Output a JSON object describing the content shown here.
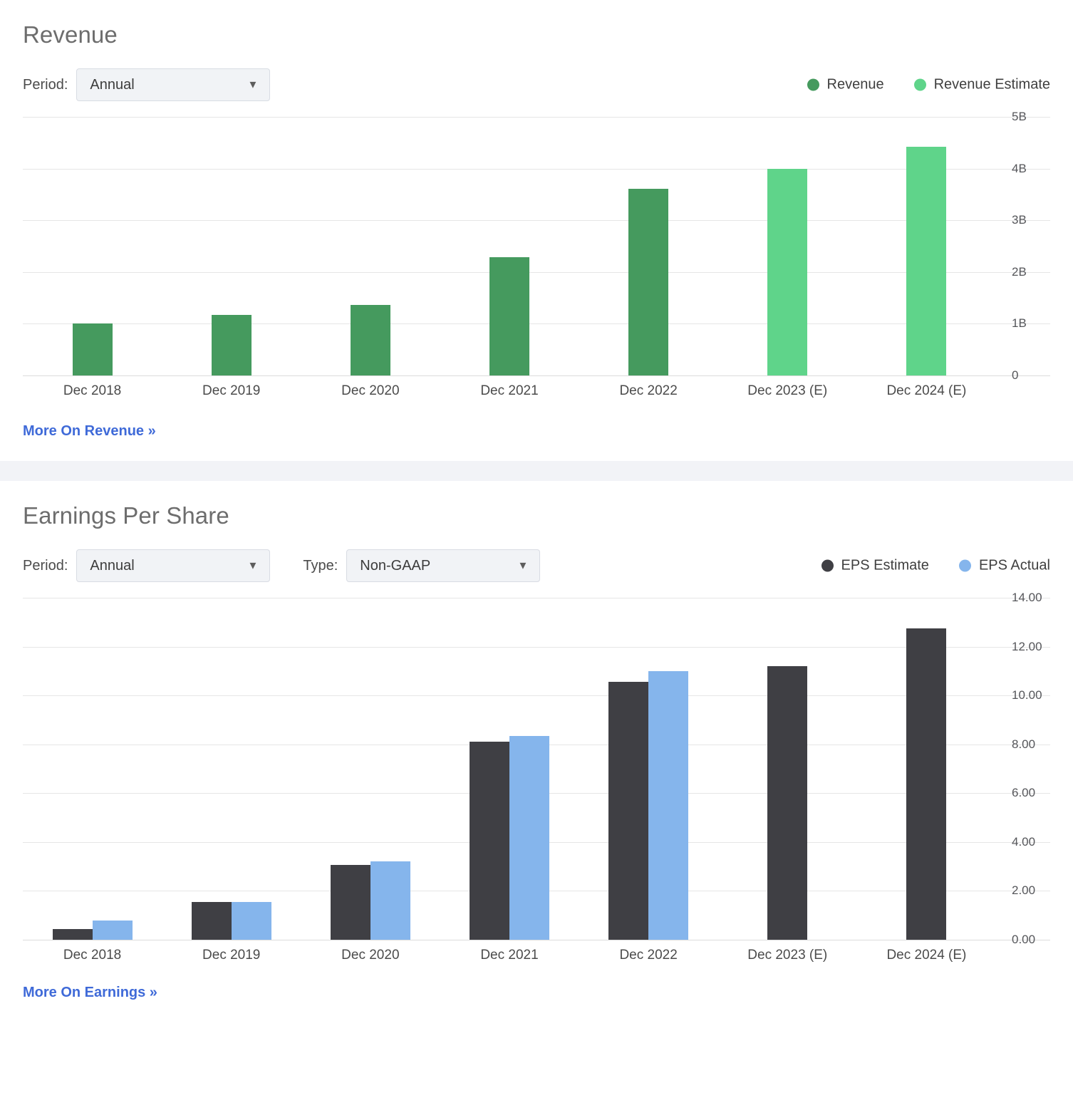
{
  "revenue_section": {
    "title": "Revenue",
    "period": {
      "label": "Period:",
      "value": "Annual",
      "caret": "▼"
    },
    "legend": [
      {
        "name": "Revenue",
        "color": "#459a5e"
      },
      {
        "name": "Revenue Estimate",
        "color": "#5fd48a"
      }
    ],
    "more_link": "More On Revenue »"
  },
  "eps_section": {
    "title": "Earnings Per Share",
    "period": {
      "label": "Period:",
      "value": "Annual",
      "caret": "▼"
    },
    "type": {
      "label": "Type:",
      "value": "Non-GAAP",
      "caret": "▼"
    },
    "legend": [
      {
        "name": "EPS Estimate",
        "color": "#3f3f44"
      },
      {
        "name": "EPS Actual",
        "color": "#85b5ec"
      }
    ],
    "more_link": "More On Earnings »"
  },
  "chart_data": [
    {
      "type": "bar",
      "id": "revenue",
      "title": "Revenue",
      "xlabel": "",
      "ylabel": "",
      "categories": [
        "Dec 2018",
        "Dec 2019",
        "Dec 2020",
        "Dec 2021",
        "Dec 2022",
        "Dec 2023 (E)",
        "Dec 2024 (E)"
      ],
      "ytick_labels": [
        "0",
        "1B",
        "2B",
        "3B",
        "4B",
        "5B"
      ],
      "ytick_values": [
        0,
        1000000000,
        2000000000,
        3000000000,
        4000000000,
        5000000000
      ],
      "ylim": [
        0,
        5000000000
      ],
      "grid": true,
      "legend_position": "top-right",
      "series": [
        {
          "name": "Revenue",
          "color": "#459a5e",
          "values": [
            1010000000,
            1170000000,
            1360000000,
            2280000000,
            3610000000,
            null,
            null
          ]
        },
        {
          "name": "Revenue Estimate",
          "color": "#5fd48a",
          "values": [
            null,
            null,
            null,
            null,
            null,
            4000000000,
            4420000000
          ]
        }
      ]
    },
    {
      "type": "bar",
      "id": "eps",
      "title": "Earnings Per Share",
      "xlabel": "",
      "ylabel": "",
      "categories": [
        "Dec 2018",
        "Dec 2019",
        "Dec 2020",
        "Dec 2021",
        "Dec 2022",
        "Dec 2023 (E)",
        "Dec 2024 (E)"
      ],
      "ytick_labels": [
        "0.00",
        "2.00",
        "4.00",
        "6.00",
        "8.00",
        "10.00",
        "12.00",
        "14.00"
      ],
      "ytick_values": [
        0,
        2,
        4,
        6,
        8,
        10,
        12,
        14
      ],
      "ylim": [
        0,
        14
      ],
      "grid": true,
      "legend_position": "top-right",
      "series": [
        {
          "name": "EPS Estimate",
          "color": "#3f3f44",
          "values": [
            0.45,
            1.55,
            3.05,
            8.1,
            10.55,
            11.2,
            12.75
          ]
        },
        {
          "name": "EPS Actual",
          "color": "#85b5ec",
          "values": [
            0.8,
            1.55,
            3.2,
            8.35,
            11.0,
            null,
            null
          ]
        }
      ]
    }
  ]
}
